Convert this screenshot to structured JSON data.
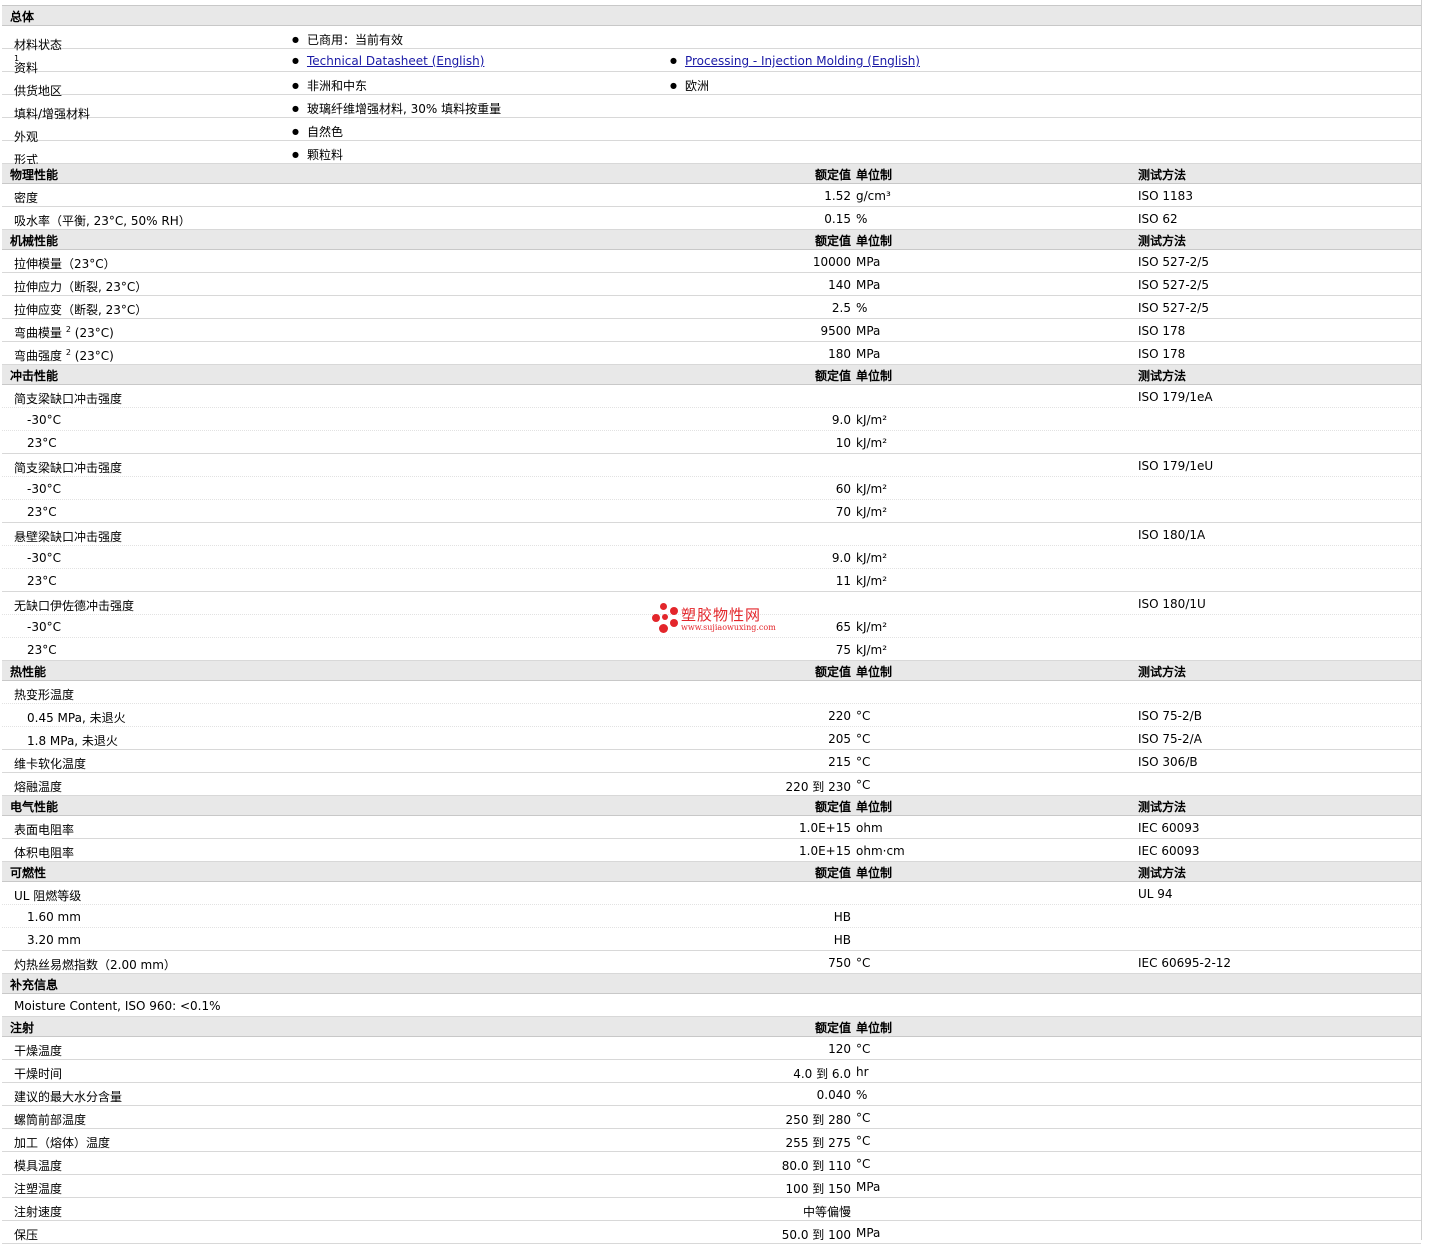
{
  "general": {
    "title": "总体",
    "rows": [
      {
        "name": "材料状态",
        "values": [
          "已商用：当前有效"
        ]
      },
      {
        "name": "资料",
        "sup": "1",
        "links": [
          "Technical Datasheet (English)",
          "Processing - Injection Molding (English)"
        ]
      },
      {
        "name": "供货地区",
        "values": [
          "非洲和中东",
          "欧洲"
        ]
      },
      {
        "name": "填料/增强材料",
        "values": [
          "玻璃纤维增强材料, 30% 填料按重量"
        ]
      },
      {
        "name": "外观",
        "values": [
          "自然色"
        ]
      },
      {
        "name": "形式",
        "values": [
          "颗粒料"
        ]
      }
    ]
  },
  "headers": {
    "value": "额定值",
    "unit": "单位制",
    "method": "测试方法"
  },
  "sections": [
    {
      "title": "物理性能",
      "rows": [
        {
          "name": "密度",
          "value": "1.52",
          "unit": "g/cm³",
          "method": "ISO 1183"
        },
        {
          "name": "吸水率（平衡, 23°C, 50% RH）",
          "value": "0.15",
          "unit": "%",
          "method": "ISO 62"
        }
      ]
    },
    {
      "title": "机械性能",
      "rows": [
        {
          "name": "拉伸模量（23°C）",
          "value": "10000",
          "unit": "MPa",
          "method": "ISO 527-2/5"
        },
        {
          "name": "拉伸应力（断裂, 23°C）",
          "value": "140",
          "unit": "MPa",
          "method": "ISO 527-2/5"
        },
        {
          "name": "拉伸应变（断裂, 23°C）",
          "value": "2.5",
          "unit": "%",
          "method": "ISO 527-2/5"
        },
        {
          "name": "弯曲模量",
          "sup": "2",
          "suffix": "(23°C)",
          "value": "9500",
          "unit": "MPa",
          "method": "ISO 178"
        },
        {
          "name": "弯曲强度",
          "sup": "2",
          "suffix": "(23°C)",
          "value": "180",
          "unit": "MPa",
          "method": "ISO 178"
        }
      ]
    },
    {
      "title": "冲击性能",
      "rows": [
        {
          "name": "简支梁缺口冲击强度",
          "method": "ISO 179/1eA",
          "sub": true
        },
        {
          "name": "-30°C",
          "indent": true,
          "value": "9.0",
          "unit": "kJ/m²",
          "sub": true
        },
        {
          "name": "23°C",
          "indent": true,
          "value": "10",
          "unit": "kJ/m²"
        },
        {
          "name": "简支梁缺口冲击强度",
          "method": "ISO 179/1eU",
          "sub": true
        },
        {
          "name": "-30°C",
          "indent": true,
          "value": "60",
          "unit": "kJ/m²",
          "sub": true
        },
        {
          "name": "23°C",
          "indent": true,
          "value": "70",
          "unit": "kJ/m²"
        },
        {
          "name": "悬壁梁缺口冲击强度",
          "method": "ISO 180/1A",
          "sub": true
        },
        {
          "name": "-30°C",
          "indent": true,
          "value": "9.0",
          "unit": "kJ/m²",
          "sub": true
        },
        {
          "name": "23°C",
          "indent": true,
          "value": "11",
          "unit": "kJ/m²"
        },
        {
          "name": "无缺口伊佐德冲击强度",
          "method": "ISO 180/1U",
          "sub": true
        },
        {
          "name": "-30°C",
          "indent": true,
          "value": "65",
          "unit": "kJ/m²",
          "sub": true
        },
        {
          "name": "23°C",
          "indent": true,
          "value": "75",
          "unit": "kJ/m²"
        }
      ]
    },
    {
      "title": "热性能",
      "rows": [
        {
          "name": "热变形温度",
          "sub": true
        },
        {
          "name": "0.45 MPa, 未退火",
          "indent": true,
          "value": "220",
          "unit": "°C",
          "method": "ISO 75-2/B",
          "sub": true
        },
        {
          "name": "1.8 MPa, 未退火",
          "indent": true,
          "value": "205",
          "unit": "°C",
          "method": "ISO 75-2/A"
        },
        {
          "name": "维卡软化温度",
          "value": "215",
          "unit": "°C",
          "method": "ISO 306/B"
        },
        {
          "name": "熔融温度",
          "value": "220 到  230",
          "unit": "°C"
        }
      ]
    },
    {
      "title": "电气性能",
      "rows": [
        {
          "name": "表面电阻率",
          "value": "1.0E+15",
          "unit": "ohm",
          "method": "IEC 60093"
        },
        {
          "name": "体积电阻率",
          "value": "1.0E+15",
          "unit": "ohm·cm",
          "method": "IEC 60093"
        }
      ]
    },
    {
      "title": "可燃性",
      "rows": [
        {
          "name": "UL 阻燃等级",
          "method": "UL 94",
          "sub": true
        },
        {
          "name": "1.60 mm",
          "indent": true,
          "value": "HB",
          "sub": true
        },
        {
          "name": "3.20 mm",
          "indent": true,
          "value": "HB"
        },
        {
          "name": "灼热丝易燃指数（2.00 mm）",
          "value": "750",
          "unit": "°C",
          "method": "IEC 60695-2-12"
        }
      ]
    },
    {
      "title": "补充信息",
      "noHeader": true,
      "rows": [
        {
          "name": "Moisture Content, ISO 960: <0.1%"
        }
      ]
    },
    {
      "title": "注射",
      "noMethod": true,
      "rows": [
        {
          "name": "干燥温度",
          "value": "120",
          "unit": "°C"
        },
        {
          "name": "干燥时间",
          "value": "4.0 到  6.0",
          "unit": "hr"
        },
        {
          "name": "建议的最大水分含量",
          "value": "0.040",
          "unit": "%"
        },
        {
          "name": "螺筒前部温度",
          "value": "250 到  280",
          "unit": "°C"
        },
        {
          "name": "加工（熔体）温度",
          "value": "255 到  275",
          "unit": "°C"
        },
        {
          "name": "模具温度",
          "value": "80.0 到  110",
          "unit": "°C"
        },
        {
          "name": "注塑温度",
          "value": "100 到  150",
          "unit": "MPa"
        },
        {
          "name": "注射速度",
          "value": "中等偏慢"
        },
        {
          "name": "保压",
          "value": "50.0 到  100",
          "unit": "MPa"
        }
      ]
    }
  ],
  "watermark": {
    "brand": "塑胶物性网",
    "url": "www.sujiaowuxing.com",
    "color": "#e3262b"
  }
}
